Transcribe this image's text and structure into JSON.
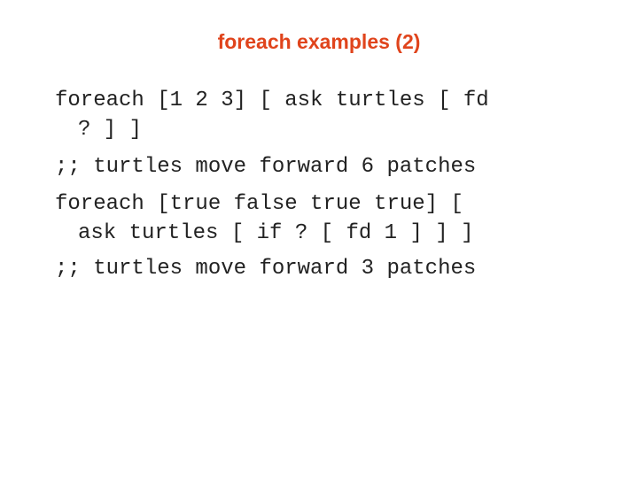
{
  "slide": {
    "title": "foreach examples (2)",
    "title_color": "#e0441c",
    "code_lines": [
      "foreach [1 2 3] [ ask turtles [ fd",
      "? ] ]",
      ";; turtles move forward 6 patches",
      "foreach [true false true true] [",
      "ask turtles [ if ? [ fd 1 ] ] ]",
      ";; turtles move forward 3 patches"
    ]
  }
}
